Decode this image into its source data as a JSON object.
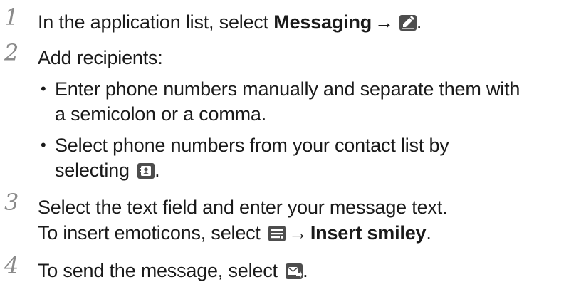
{
  "steps": [
    {
      "number": "1",
      "text_before": "In the application list, select ",
      "bold_text": "Messaging",
      "arrow": "→",
      "icon": "compose-icon",
      "text_after": "."
    },
    {
      "number": "2",
      "text": "Add recipients:",
      "bullets": [
        {
          "dot": "•",
          "line1": "Enter phone numbers manually and separate them with",
          "line2": "a semicolon or a comma."
        },
        {
          "dot": "•",
          "line1": "Select phone numbers from your contact list by",
          "line2_before": "selecting ",
          "icon": "contacts-icon",
          "line2_after": "."
        }
      ]
    },
    {
      "number": "3",
      "line1": "Select the text field and enter your message text.",
      "line2_before": "To insert emoticons, select ",
      "icon": "menu-icon",
      "arrow": "→",
      "bold_text": "Insert smiley",
      "line2_after": "."
    },
    {
      "number": "4",
      "text_before": "To send the message, select ",
      "icon": "send-message-icon",
      "text_after": "."
    }
  ],
  "colors": {
    "text": "#1a1a1a",
    "step_number": "#8a8a8a",
    "icon_bg": "#4d4d4d"
  }
}
